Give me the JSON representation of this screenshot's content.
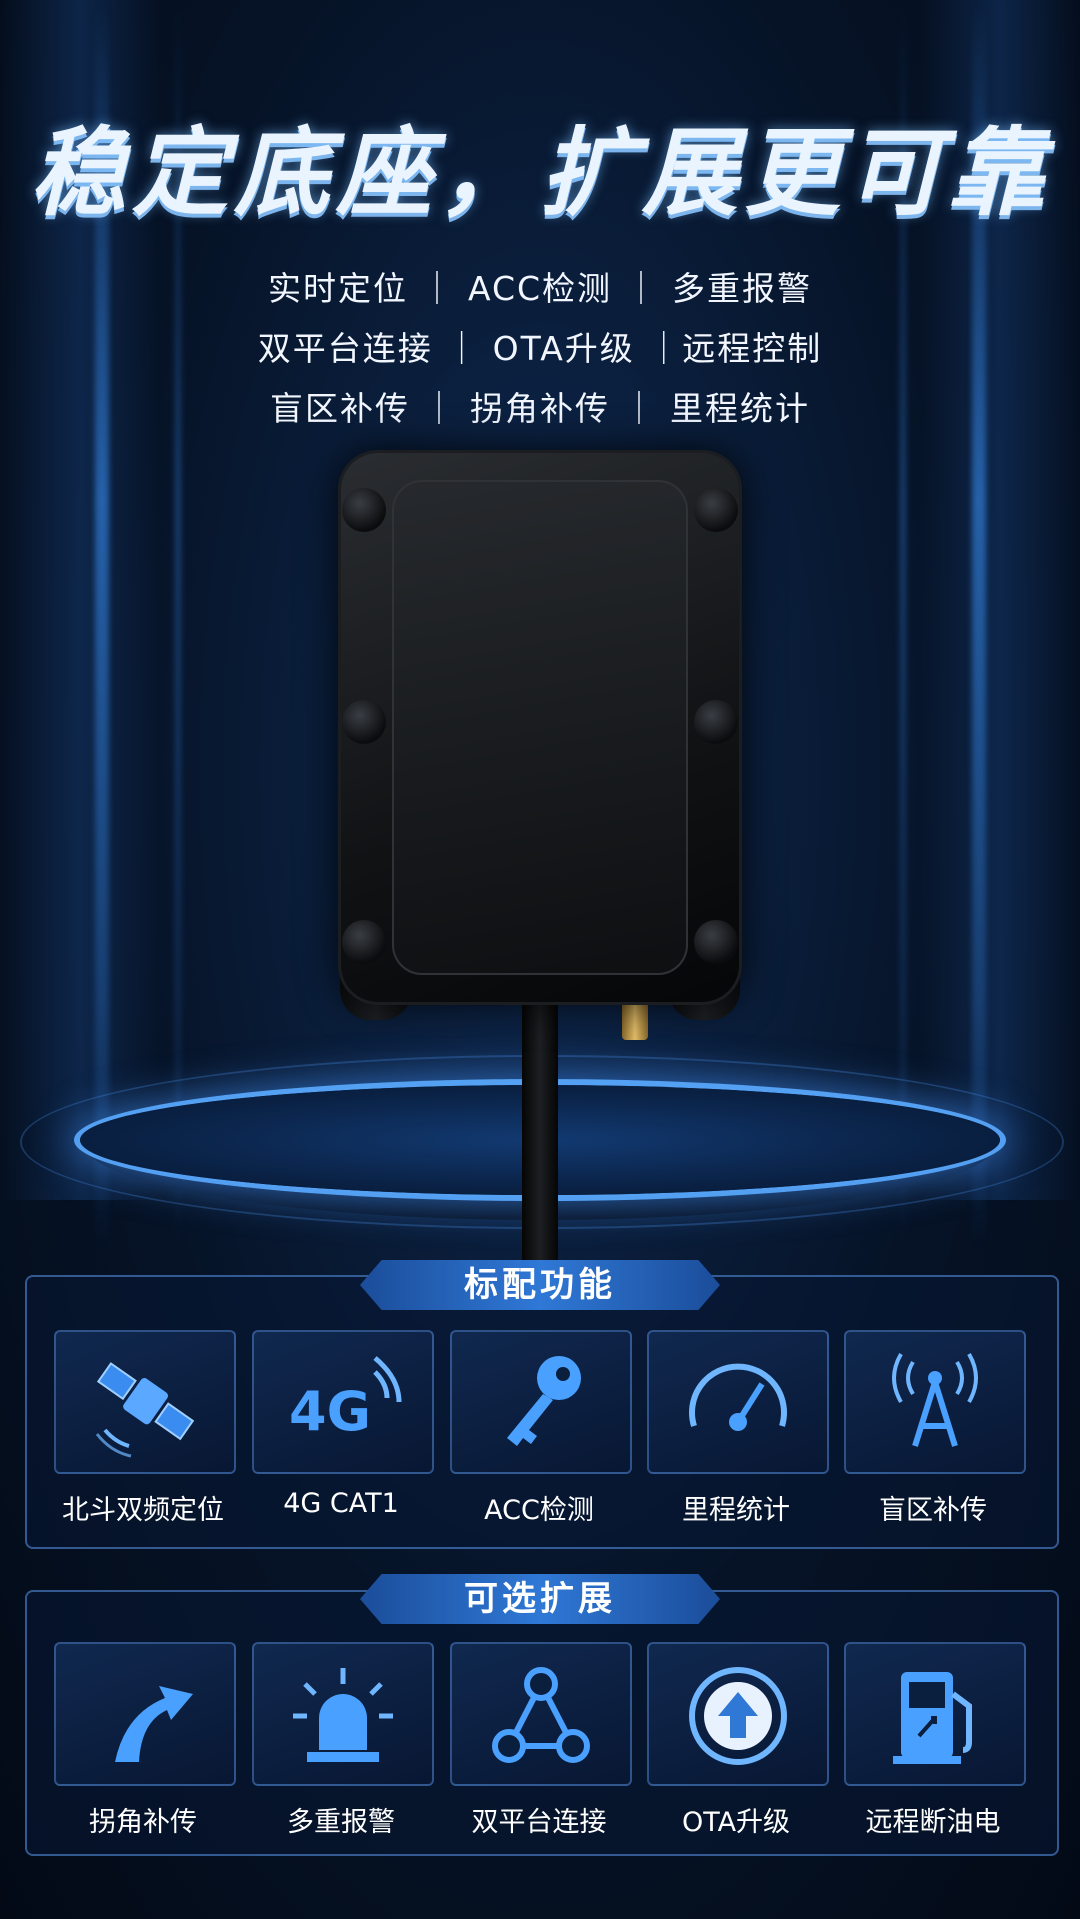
{
  "headline": "稳定底座，扩展更可靠",
  "feature_lines": [
    "实时定位 ｜ ACC检测 ｜ 多重报警",
    "双平台连接 ｜ OTA升级 ｜远程控制",
    "盲区补传 ｜ 拐角补传 ｜ 里程统计"
  ],
  "standard": {
    "title": "标配功能",
    "items": [
      {
        "label": "北斗双频定位",
        "icon": "satellite-icon"
      },
      {
        "label": "4G CAT1",
        "icon": "4g-signal-icon",
        "icon_text": "4G"
      },
      {
        "label": "ACC检测",
        "icon": "key-icon"
      },
      {
        "label": "里程统计",
        "icon": "speedometer-icon"
      },
      {
        "label": "盲区补传",
        "icon": "broadcast-tower-icon"
      }
    ]
  },
  "optional": {
    "title": "可选扩展",
    "items": [
      {
        "label": "拐角补传",
        "icon": "curved-road-icon"
      },
      {
        "label": "多重报警",
        "icon": "alarm-light-icon"
      },
      {
        "label": "双平台连接",
        "icon": "network-nodes-icon"
      },
      {
        "label": "OTA升级",
        "icon": "upload-arrow-icon"
      },
      {
        "label": "远程断油电",
        "icon": "fuel-pump-icon"
      }
    ]
  },
  "colors": {
    "accent": "#2f78d6",
    "background": "#061327",
    "glow": "#5aaaff"
  }
}
